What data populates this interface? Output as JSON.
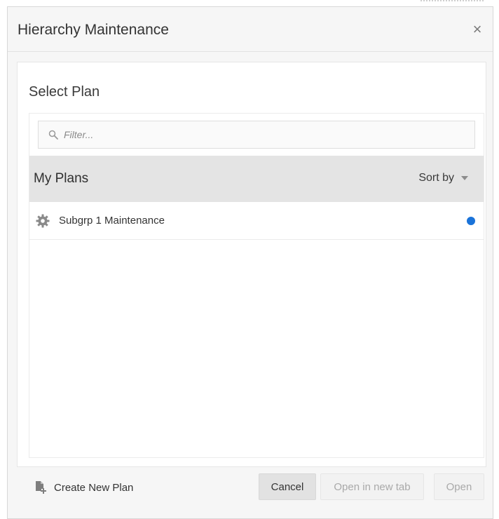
{
  "dialog": {
    "title": "Hierarchy Maintenance",
    "close_symbol": "×"
  },
  "panel": {
    "section_title": "Select Plan",
    "filter": {
      "placeholder": "Filter...",
      "value": ""
    },
    "plans_header": {
      "title": "My Plans",
      "sort_label": "Sort by"
    },
    "plans": [
      {
        "name": "Subgrp 1 Maintenance",
        "icon": "gear-icon",
        "status_color": "#1a73d9"
      }
    ]
  },
  "footer": {
    "create_label": "Create New Plan",
    "cancel_label": "Cancel",
    "open_new_tab_label": "Open in new tab",
    "open_label": "Open"
  },
  "colors": {
    "accent": "#1a73d9",
    "header_band": "#e4e4e4",
    "disabled_text": "#a9a9a9"
  }
}
